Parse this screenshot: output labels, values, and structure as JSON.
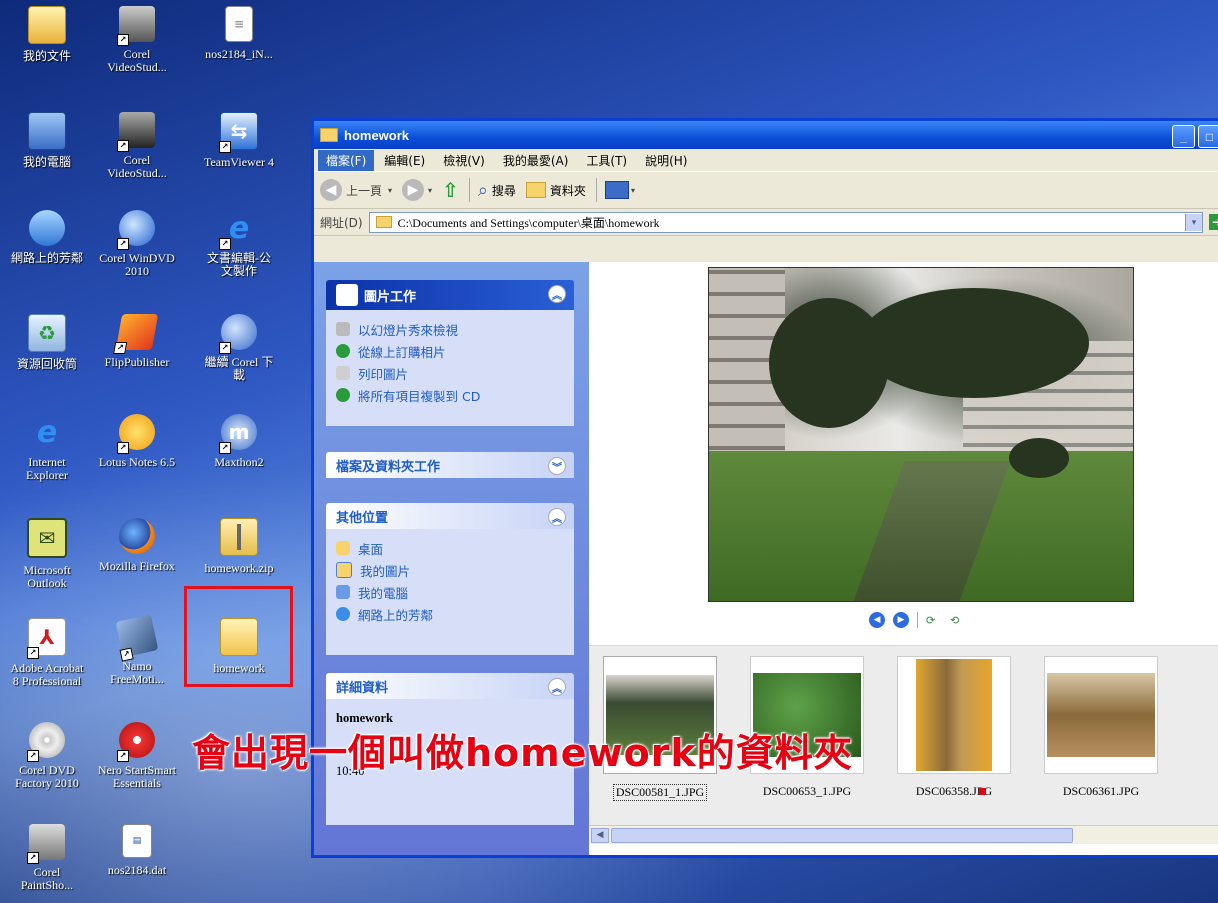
{
  "desktop": {
    "icons": [
      {
        "label": "我的文件"
      },
      {
        "label": "Corel\nVideoStud..."
      },
      {
        "label": "nos2184_iN..."
      },
      {
        "label": "我的電腦"
      },
      {
        "label": "Corel\nVideoStud..."
      },
      {
        "label": "TeamViewer 4"
      },
      {
        "label": "網路上的芳鄰"
      },
      {
        "label": "Corel WinDVD\n2010"
      },
      {
        "label": "文書編輯-公\n文製作"
      },
      {
        "label": "資源回收筒"
      },
      {
        "label": "FlipPublisher"
      },
      {
        "label": "繼續 Corel 下\n載"
      },
      {
        "label": "Internet\nExplorer"
      },
      {
        "label": "Lotus Notes 6.5"
      },
      {
        "label": "Maxthon2"
      },
      {
        "label": "Microsoft\nOutlook"
      },
      {
        "label": "Mozilla Firefox"
      },
      {
        "label": "homework.zip"
      },
      {
        "label": "Adobe Acrobat\n8 Professional"
      },
      {
        "label": "Namo\nFreeMoti..."
      },
      {
        "label": "homework"
      },
      {
        "label": "Corel DVD\nFactory 2010"
      },
      {
        "label": "Nero StartSmart\nEssentials"
      },
      {
        "label": "Corel\nPaintSho..."
      },
      {
        "label": "nos2184.dat"
      }
    ],
    "annotation": "會出現一個叫做homework的資料夾"
  },
  "window": {
    "title": "homework",
    "menu": [
      "檔案(F)",
      "編輯(E)",
      "檢視(V)",
      "我的最愛(A)",
      "工具(T)",
      "說明(H)"
    ],
    "toolbar": {
      "back": "上一頁",
      "search": "搜尋",
      "folders": "資料夾"
    },
    "address": {
      "label": "網址(D)",
      "path": "C:\\Documents and Settings\\computer\\桌面\\homework",
      "go": "移"
    },
    "taskpane": {
      "picture_tasks": {
        "title": "圖片工作",
        "items": [
          "以幻燈片秀來檢視",
          "從線上訂購相片",
          "列印圖片",
          "將所有項目複製到 CD"
        ]
      },
      "file_tasks": {
        "title": "檔案及資料夾工作"
      },
      "other_places": {
        "title": "其他位置",
        "items": [
          "桌面",
          "我的圖片",
          "我的電腦",
          "網路上的芳鄰"
        ]
      },
      "details": {
        "title": "詳細資料",
        "name": "homework",
        "time": "10:40"
      }
    },
    "filmstrip": [
      {
        "name": "DSC00581_1.JPG"
      },
      {
        "name": "DSC00653_1.JPG"
      },
      {
        "name": "DSC06358.JPG"
      },
      {
        "name": "DSC06361.JPG"
      }
    ]
  }
}
